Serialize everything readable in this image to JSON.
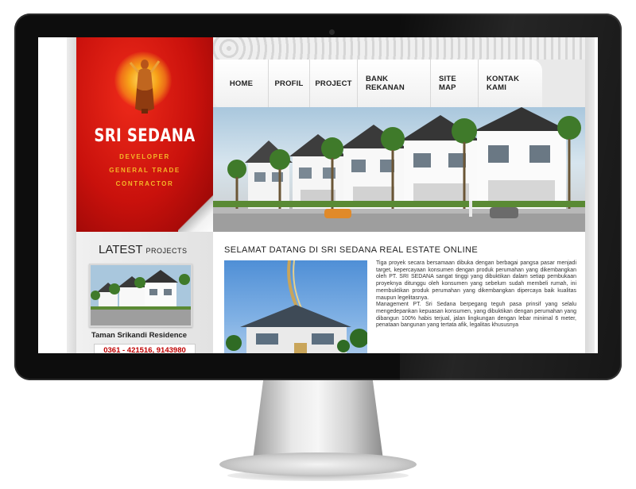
{
  "site": {
    "brand": {
      "name": "SRI SEDANA",
      "lines": [
        "DEVELOPER",
        "GENERAL TRADE",
        "CONTRACTOR"
      ]
    },
    "nav": [
      "HOME",
      "PROFIL",
      "PROJECT",
      "BANK REKANAN",
      "SITE MAP",
      "KONTAK KAMI"
    ],
    "sidebar": {
      "title_big": "LATEST",
      "title_small": "PROJECTS",
      "project_name": "Taman Srikandi Residence",
      "phone": "0361 - 421516, 9143980"
    },
    "main": {
      "heading": "SELAMAT DATANG DI SRI SEDANA REAL ESTATE ONLINE",
      "paragraphs": [
        "Tiga proyek secara bersamaan dibuka dengan berbagai pangsa pasar menjadi target, kepercayaan konsumen dengan produk perumahan yang dikembangkan oleh PT. SRI SEDANA sangat tinggi yang dibuktikan dalam setiap pembukaan proyeknya ditunggu oleh konsumen yang sebelum sudah membeli rumah, ini membuktikan produk perumahan yang dikembangkan dipercaya baik kualitas maupun legelitasnya.",
        "Management PT. Sri Sedana berpegang teguh pasa prinsif yang selalu mengedepankan kepuasan konsumen, yang dibuktikan dengan perumahan yang dibangun 100% habis terjual, jalan lingkungan dengan lebar minimal 6 meter, penataan bangunan yang tertata afik, legalitas khususnya"
      ]
    }
  },
  "colors": {
    "brand_red": "#c9110c",
    "brand_gold": "#f4b728",
    "phone_red": "#c00000"
  }
}
